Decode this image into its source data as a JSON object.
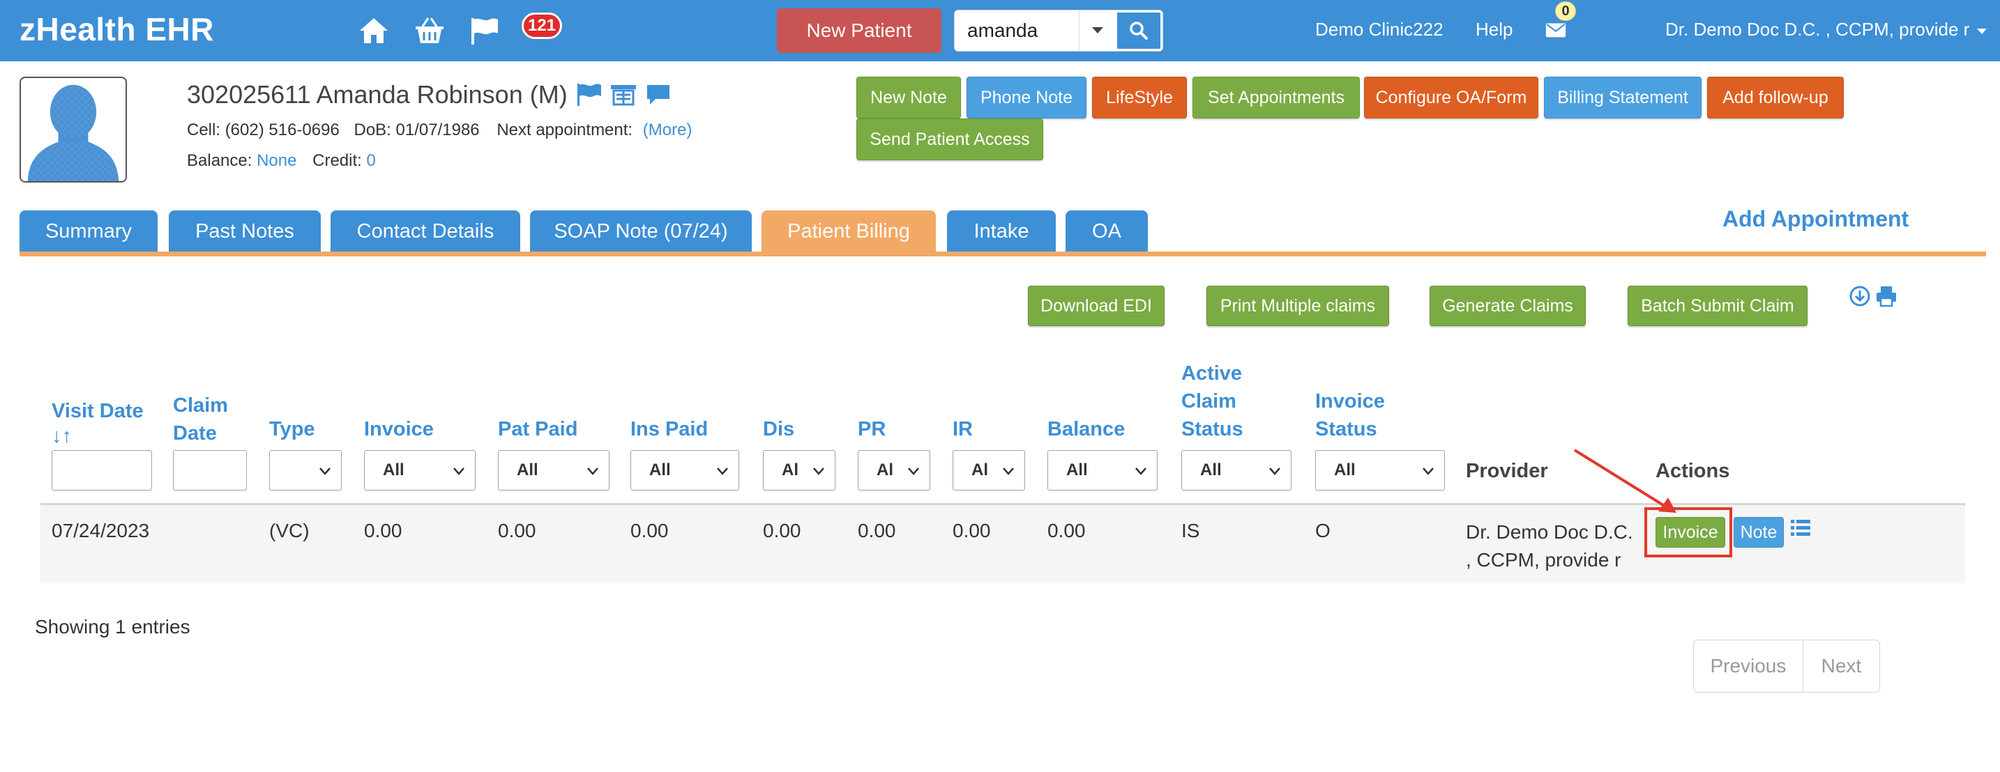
{
  "app": {
    "title": "zHealth EHR"
  },
  "topnav": {
    "notification_count": "121",
    "new_patient_label": "New Patient",
    "search_value": "amanda",
    "clinic_label": "Demo Clinic222",
    "help_label": "Help",
    "mail_count": "0",
    "user_label": "Dr. Demo Doc D.C. , CCPM, provide r",
    "icons": [
      "home-icon",
      "basket-icon",
      "flag-icon",
      "search-icon",
      "mail-icon",
      "caret-down-icon"
    ]
  },
  "patient": {
    "title": "302025611 Amanda Robinson (M)",
    "cell_label": "Cell:",
    "cell": "(602) 516-0696",
    "dob_label": "DoB:",
    "dob": "01/07/1986",
    "next_appt_label": "Next appointment:",
    "more_label": "(More)",
    "balance_label": "Balance:",
    "balance": "None",
    "credit_label": "Credit:",
    "credit": "0"
  },
  "patient_actions": {
    "new_note": "New Note",
    "phone_note": "Phone Note",
    "lifestyle": "LifeStyle",
    "set_appointments": "Set Appointments",
    "configure_oa": "Configure OA/Form",
    "billing_statement": "Billing Statement",
    "add_followup": "Add follow-up",
    "send_access": "Send Patient Access"
  },
  "tabs": [
    "Summary",
    "Past Notes",
    "Contact Details",
    "SOAP Note (07/24)",
    "Patient Billing",
    "Intake",
    "OA"
  ],
  "active_tab": "Patient Billing",
  "add_appointment_label": "Add Appointment",
  "toolbar": {
    "download_edi": "Download EDI",
    "print_multiple": "Print Multiple claims",
    "generate_claims": "Generate Claims",
    "batch_submit": "Batch Submit Claim"
  },
  "table": {
    "headers": {
      "visit_date": "Visit Date",
      "sort_glyph": "↓↑",
      "claim_date_1": "Claim",
      "claim_date_2": "Date",
      "type": "Type",
      "invoice": "Invoice",
      "pat_paid": "Pat Paid",
      "ins_paid": "Ins Paid",
      "dis": "Dis",
      "pr": "PR",
      "ir": "IR",
      "balance": "Balance",
      "active_claim_1": "Active",
      "active_claim_2": "Claim",
      "active_claim_3": "Status",
      "invoice_status_1": "Invoice",
      "invoice_status_2": "Status",
      "provider": "Provider",
      "actions": "Actions"
    },
    "filters": {
      "invoice": "All",
      "pat_paid": "All",
      "ins_paid": "All",
      "dis": "Al",
      "pr": "Al",
      "ir": "Al",
      "balance": "All",
      "active_claim": "All",
      "invoice_status": "All"
    },
    "rows": [
      {
        "visit_date": "07/24/2023",
        "claim_date": "",
        "type": "(VC)",
        "invoice": "0.00",
        "pat_paid": "0.00",
        "ins_paid": "0.00",
        "dis": "0.00",
        "pr": "0.00",
        "ir": "0.00",
        "balance": "0.00",
        "active_claim_status": "IS",
        "invoice_status": "O",
        "provider_line1": "Dr. Demo Doc D.C.",
        "provider_line2": ", CCPM, provide r",
        "invoice_btn": "Invoice",
        "note_btn": "Note"
      }
    ],
    "showing": "Showing 1 entries",
    "previous": "Previous",
    "next": "Next"
  },
  "colors": {
    "nav_blue": "#3d8fd6",
    "tab_active": "#f2a965",
    "green": "#7bab43",
    "orange": "#de5f22",
    "red_button": "#c95454",
    "highlight": "#e23a2a"
  }
}
